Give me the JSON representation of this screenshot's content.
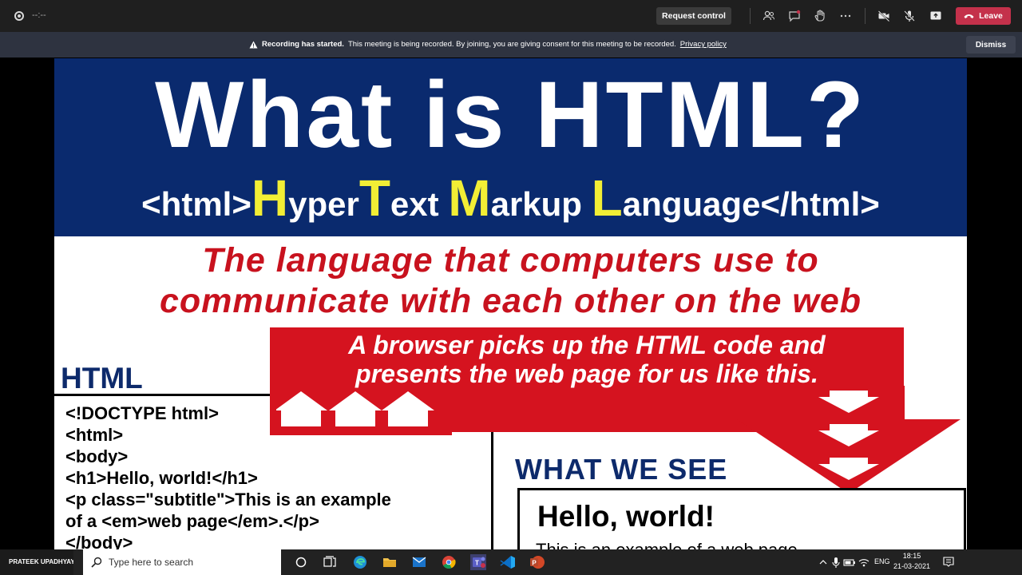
{
  "meeting": {
    "timer": "--:--",
    "request_control": "Request control",
    "leave": "Leave"
  },
  "banner": {
    "title": "Recording has started.",
    "message": "This meeting is being recorded. By joining, you are giving consent for this meeting to be recorded.",
    "link": "Privacy policy",
    "dismiss": "Dismiss"
  },
  "slide": {
    "title": "What is HTML?",
    "acronym": {
      "open_tag": "<html>",
      "close_tag": "</html>",
      "words": [
        {
          "cap": "H",
          "rest": "yper"
        },
        {
          "cap": "T",
          "rest": "ext "
        },
        {
          "cap": "M",
          "rest": "arkup "
        },
        {
          "cap": "L",
          "rest": "anguage"
        }
      ]
    },
    "definition_line1": "The language that computers use to",
    "definition_line2": "communicate with each other on the web",
    "browser_line1": "A browser picks up the HTML code and",
    "browser_line2": "presents the web page for us like this.",
    "html_heading": "HTML",
    "code": [
      "<!DOCTYPE html>",
      "<html>",
      "<body>",
      "<h1>Hello, world!</h1>",
      "<p class=\"subtitle\">This is an example",
      "of a <em>web page</em>.</p>",
      "</body>"
    ],
    "what_we_see": "WHAT WE SEE",
    "rendered_heading": "Hello, world!",
    "rendered_sub": "This is an example of a web page."
  },
  "taskbar": {
    "user_name": "PRATEEK UPADHYAY",
    "search_placeholder": "Type here to search",
    "lang": "ENG",
    "time": "18:15",
    "date": "21-03-2021"
  },
  "colors": {
    "slide_blue": "#0a2a6e",
    "accent_yellow": "#f2ee35",
    "accent_red": "#d5131f",
    "leave_red": "#c4314b"
  }
}
